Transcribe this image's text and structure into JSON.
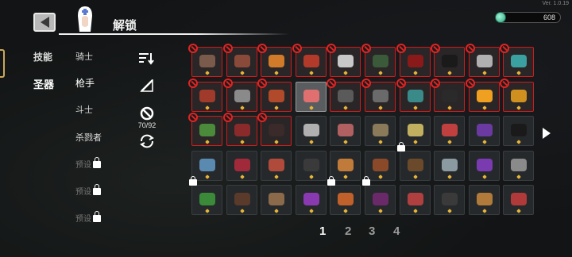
{
  "version": "Ver. 1.0.19",
  "header": {
    "title": "解锁"
  },
  "currency": {
    "value": "608",
    "icon": "gem-icon"
  },
  "categories": [
    {
      "label": "技能"
    },
    {
      "label": "圣器"
    }
  ],
  "characters": [
    {
      "label": "骑士"
    },
    {
      "label": "枪手"
    },
    {
      "label": "斗士"
    },
    {
      "label": "杀戮者"
    },
    {
      "label": "预设"
    },
    {
      "label": "预设"
    },
    {
      "label": "预设"
    }
  ],
  "tools": {
    "count": "70/92"
  },
  "pagination": [
    "1",
    "2",
    "3",
    "4"
  ],
  "colors": {
    "ban_red": "#d21b1b",
    "gold": "#e7b437",
    "accent_gem": "#2aa27c"
  },
  "grid": {
    "rows": [
      [
        "red",
        "red",
        "red",
        "red",
        "red",
        "red",
        "red",
        "red",
        "red",
        "red"
      ],
      [
        "red",
        "red",
        "red",
        "sel",
        "red",
        "red",
        "red",
        "red",
        "red",
        "red"
      ],
      [
        "red",
        "red",
        "red",
        "norm",
        "norm",
        "norm",
        "norm",
        "norm",
        "norm",
        "norm"
      ],
      [
        "norm",
        "norm",
        "norm",
        "norm",
        "norm",
        "norm",
        "norm",
        "norm",
        "norm",
        "norm"
      ],
      [
        "norm",
        "norm",
        "norm",
        "norm",
        "norm",
        "norm",
        "norm",
        "norm",
        "norm",
        "norm"
      ]
    ],
    "art_colors": [
      [
        "#7a5a4a",
        "#8a4a3a",
        "#d07a2a",
        "#b23a2a",
        "#c8c8c8",
        "#3a5a3a",
        "#8a1a1a",
        "#1a1a1a",
        "#b0b0b0",
        "#3aa0a0"
      ],
      [
        "#a03a2a",
        "#8a8a8a",
        "#b04a2a",
        "#e07070",
        "#5a5a5a",
        "#6a6a6a",
        "#3a8a8a",
        "#2a2a2a",
        "#f0a020",
        "#d09020"
      ],
      [
        "#4a8a3a",
        "#8a2a2a",
        "#3a2a2a",
        "#b0b0b0",
        "#b06060",
        "#8a7a5a",
        "#c0b060",
        "#c04040",
        "#6a3aa0",
        "#1a1a1a"
      ],
      [
        "#5a8ab0",
        "#a02a3a",
        "#b04a3a",
        "#3a3a3a",
        "#c07a3a",
        "#8a4a2a",
        "#6a4a2a",
        "#8a9aa0",
        "#7a3ab0",
        "#8a8a8a"
      ],
      [
        "#3a8a3a",
        "#5a3a2a",
        "#8a6a4a",
        "#8a3ab0",
        "#c0602a",
        "#6a2a6a",
        "#b04040",
        "#3a3a3a",
        "#b07a3a",
        "#b03a3a"
      ]
    ],
    "locks": [
      [
        3,
        6
      ],
      [
        4,
        0
      ],
      [
        4,
        4
      ],
      [
        4,
        5
      ]
    ]
  }
}
